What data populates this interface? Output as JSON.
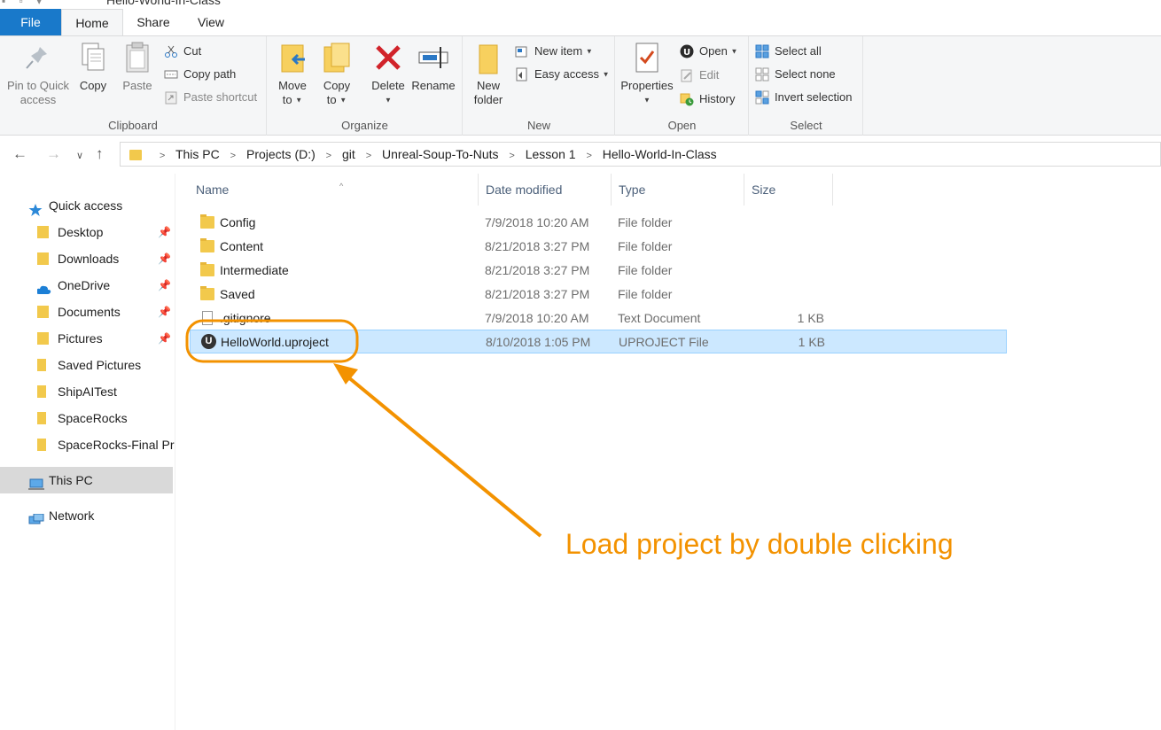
{
  "window": {
    "title": "Hello-World-In-Class"
  },
  "ribbon_tabs": [
    "File",
    "Home",
    "Share",
    "View"
  ],
  "clipboard": {
    "label": "Clipboard",
    "pin": "Pin to Quick access",
    "copy": "Copy",
    "paste": "Paste",
    "cut": "Cut",
    "copy_path": "Copy path",
    "paste_shortcut": "Paste shortcut"
  },
  "organize": {
    "label": "Organize",
    "move_to": "Move to",
    "copy_to": "Copy to",
    "delete": "Delete",
    "rename": "Rename"
  },
  "new_group": {
    "label": "New",
    "new_folder": "New folder",
    "new_item": "New item",
    "easy_access": "Easy access"
  },
  "open_group": {
    "label": "Open",
    "properties": "Properties",
    "open": "Open",
    "edit": "Edit",
    "history": "History"
  },
  "select_group": {
    "label": "Select",
    "select_all": "Select all",
    "select_none": "Select none",
    "invert": "Invert selection"
  },
  "breadcrumb": [
    "This PC",
    "Projects (D:)",
    "git",
    "Unreal-Soup-To-Nuts",
    "Lesson 1",
    "Hello-World-In-Class"
  ],
  "nav": {
    "quick_access": "Quick access",
    "items": [
      "Desktop",
      "Downloads",
      "OneDrive",
      "Documents",
      "Pictures",
      "Saved Pictures",
      "ShipAITest",
      "SpaceRocks",
      "SpaceRocks-Final Pr"
    ],
    "this_pc": "This PC",
    "network": "Network"
  },
  "columns": {
    "name": "Name",
    "date": "Date modified",
    "type": "Type",
    "size": "Size"
  },
  "files": [
    {
      "name": "Config",
      "date": "7/9/2018 10:20 AM",
      "type": "File folder",
      "size": ""
    },
    {
      "name": "Content",
      "date": "8/21/2018 3:27 PM",
      "type": "File folder",
      "size": ""
    },
    {
      "name": "Intermediate",
      "date": "8/21/2018 3:27 PM",
      "type": "File folder",
      "size": ""
    },
    {
      "name": "Saved",
      "date": "8/21/2018 3:27 PM",
      "type": "File folder",
      "size": ""
    },
    {
      "name": ".gitignore",
      "date": "7/9/2018 10:20 AM",
      "type": "Text Document",
      "size": "1 KB"
    },
    {
      "name": "HelloWorld.uproject",
      "date": "8/10/2018 1:05 PM",
      "type": "UPROJECT File",
      "size": "1 KB"
    }
  ],
  "annotation": {
    "text": "Load project by double clicking",
    "color": "#f39200"
  },
  "colors": {
    "accent": "#1979ca",
    "selection": "#cce8ff",
    "folder": "#f2c94c"
  }
}
